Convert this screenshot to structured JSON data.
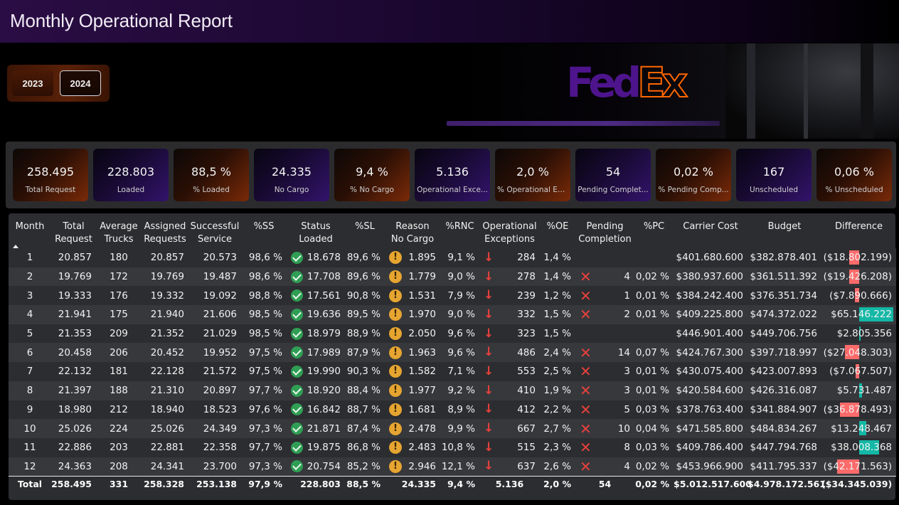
{
  "title": "Monthly Operational Report",
  "years": [
    "2023",
    "2024"
  ],
  "selected_year": "2024",
  "logo": {
    "part1": "Fed",
    "part2": "Ex"
  },
  "kpis": [
    {
      "value": "258.495",
      "label": "Total Request",
      "theme": "orange"
    },
    {
      "value": "228.803",
      "label": "Loaded",
      "theme": "purple"
    },
    {
      "value": "88,5 %",
      "label": "% Loaded",
      "theme": "orange"
    },
    {
      "value": "24.335",
      "label": "No Cargo",
      "theme": "purple"
    },
    {
      "value": "9,4 %",
      "label": "% No Cargo",
      "theme": "orange"
    },
    {
      "value": "5.136",
      "label": "Operational Exce...",
      "theme": "purple"
    },
    {
      "value": "2,0 %",
      "label": "% Operational Exce...",
      "theme": "orange"
    },
    {
      "value": "54",
      "label": "Pending Complet...",
      "theme": "purple"
    },
    {
      "value": "0,02 %",
      "label": "% Pending Comp...",
      "theme": "orange"
    },
    {
      "value": "167",
      "label": "Unscheduled",
      "theme": "purple"
    },
    {
      "value": "0,06 %",
      "label": "% Unscheduled",
      "theme": "orange"
    }
  ],
  "table": {
    "headers": [
      [
        "Month"
      ],
      [
        "Total",
        "Request"
      ],
      [
        "Average",
        "Trucks"
      ],
      [
        "Assigned",
        "Requests"
      ],
      [
        "Successful",
        "Service"
      ],
      [
        "%SS"
      ],
      [
        "Status",
        "Loaded"
      ],
      [
        "%SL"
      ],
      [
        "Reason",
        "No Cargo"
      ],
      [
        "%RNC"
      ],
      [
        "Operational",
        "Exceptions"
      ],
      [
        "%OE"
      ],
      [
        "Pending",
        "Completion"
      ],
      [
        "%PC"
      ],
      [
        "Carrier Cost"
      ],
      [
        "Budget"
      ],
      [
        "Difference"
      ]
    ],
    "rows": [
      {
        "month": "1",
        "total_request": "20.857",
        "avg_trucks": "180",
        "assigned": "20.857",
        "successful": "20.573",
        "pct_ss": "98,6 %",
        "status_loaded": "18.678",
        "pct_sl": "89,6 %",
        "no_cargo": "1.895",
        "pct_rnc": "9,1 %",
        "op_exceptions": "284",
        "pct_oe": "1,4 %",
        "pending": "",
        "pct_pc": "",
        "carrier_cost": "$401.680.600",
        "budget": "$382.878.401",
        "difference": "($18.802.199)",
        "diff_value": -18802199
      },
      {
        "month": "2",
        "total_request": "19.769",
        "avg_trucks": "172",
        "assigned": "19.769",
        "successful": "19.487",
        "pct_ss": "98,6 %",
        "status_loaded": "17.708",
        "pct_sl": "89,6 %",
        "no_cargo": "1.779",
        "pct_rnc": "9,0 %",
        "op_exceptions": "278",
        "pct_oe": "1,4 %",
        "pending": "4",
        "pct_pc": "0,02 %",
        "carrier_cost": "$380.937.600",
        "budget": "$361.511.392",
        "difference": "($19.426.208)",
        "diff_value": -19426208
      },
      {
        "month": "3",
        "total_request": "19.333",
        "avg_trucks": "176",
        "assigned": "19.332",
        "successful": "19.092",
        "pct_ss": "98,8 %",
        "status_loaded": "17.561",
        "pct_sl": "90,8 %",
        "no_cargo": "1.531",
        "pct_rnc": "7,9 %",
        "op_exceptions": "239",
        "pct_oe": "1,2 %",
        "pending": "1",
        "pct_pc": "0,01 %",
        "carrier_cost": "$384.242.400",
        "budget": "$376.351.734",
        "difference": "($7.890.666)",
        "diff_value": -7890666
      },
      {
        "month": "4",
        "total_request": "21.941",
        "avg_trucks": "175",
        "assigned": "21.940",
        "successful": "21.606",
        "pct_ss": "98,5 %",
        "status_loaded": "19.636",
        "pct_sl": "89,5 %",
        "no_cargo": "1.970",
        "pct_rnc": "9,0 %",
        "op_exceptions": "332",
        "pct_oe": "1,5 %",
        "pending": "2",
        "pct_pc": "0,01 %",
        "carrier_cost": "$409.225.800",
        "budget": "$474.372.022",
        "difference": "$65.146.222",
        "diff_value": 65146222
      },
      {
        "month": "5",
        "total_request": "21.353",
        "avg_trucks": "209",
        "assigned": "21.352",
        "successful": "21.029",
        "pct_ss": "98,5 %",
        "status_loaded": "18.979",
        "pct_sl": "88,9 %",
        "no_cargo": "2.050",
        "pct_rnc": "9,6 %",
        "op_exceptions": "323",
        "pct_oe": "1,5 %",
        "pending": "",
        "pct_pc": "",
        "carrier_cost": "$446.901.400",
        "budget": "$449.706.756",
        "difference": "$2.805.356",
        "diff_value": 2805356
      },
      {
        "month": "6",
        "total_request": "20.458",
        "avg_trucks": "206",
        "assigned": "20.452",
        "successful": "19.952",
        "pct_ss": "97,5 %",
        "status_loaded": "17.989",
        "pct_sl": "87,9 %",
        "no_cargo": "1.963",
        "pct_rnc": "9,6 %",
        "op_exceptions": "486",
        "pct_oe": "2,4 %",
        "pending": "14",
        "pct_pc": "0,07 %",
        "carrier_cost": "$424.767.300",
        "budget": "$397.718.997",
        "difference": "($27.048.303)",
        "diff_value": -27048303
      },
      {
        "month": "7",
        "total_request": "22.132",
        "avg_trucks": "181",
        "assigned": "22.128",
        "successful": "21.572",
        "pct_ss": "97,5 %",
        "status_loaded": "19.990",
        "pct_sl": "90,3 %",
        "no_cargo": "1.582",
        "pct_rnc": "7,1 %",
        "op_exceptions": "553",
        "pct_oe": "2,5 %",
        "pending": "3",
        "pct_pc": "0,01 %",
        "carrier_cost": "$430.075.400",
        "budget": "$423.007.893",
        "difference": "($7.067.507)",
        "diff_value": -7067507
      },
      {
        "month": "8",
        "total_request": "21.397",
        "avg_trucks": "188",
        "assigned": "21.310",
        "successful": "20.897",
        "pct_ss": "97,7 %",
        "status_loaded": "18.920",
        "pct_sl": "88,4 %",
        "no_cargo": "1.977",
        "pct_rnc": "9,2 %",
        "op_exceptions": "410",
        "pct_oe": "1,9 %",
        "pending": "3",
        "pct_pc": "0,01 %",
        "carrier_cost": "$420.584.600",
        "budget": "$426.316.087",
        "difference": "$5.731.487",
        "diff_value": 5731487
      },
      {
        "month": "9",
        "total_request": "18.980",
        "avg_trucks": "212",
        "assigned": "18.940",
        "successful": "18.523",
        "pct_ss": "97,6 %",
        "status_loaded": "16.842",
        "pct_sl": "88,7 %",
        "no_cargo": "1.681",
        "pct_rnc": "8,9 %",
        "op_exceptions": "412",
        "pct_oe": "2,2 %",
        "pending": "5",
        "pct_pc": "0,03 %",
        "carrier_cost": "$378.763.400",
        "budget": "$341.884.907",
        "difference": "($36.878.493)",
        "diff_value": -36878493
      },
      {
        "month": "10",
        "total_request": "25.026",
        "avg_trucks": "224",
        "assigned": "25.026",
        "successful": "24.349",
        "pct_ss": "97,3 %",
        "status_loaded": "21.871",
        "pct_sl": "87,4 %",
        "no_cargo": "2.478",
        "pct_rnc": "9,9 %",
        "op_exceptions": "667",
        "pct_oe": "2,7 %",
        "pending": "10",
        "pct_pc": "0,04 %",
        "carrier_cost": "$471.585.800",
        "budget": "$484.834.267",
        "difference": "$13.248.467",
        "diff_value": 13248467
      },
      {
        "month": "11",
        "total_request": "22.886",
        "avg_trucks": "203",
        "assigned": "22.881",
        "successful": "22.358",
        "pct_ss": "97,7 %",
        "status_loaded": "19.875",
        "pct_sl": "86,8 %",
        "no_cargo": "2.483",
        "pct_rnc": "10,8 %",
        "op_exceptions": "515",
        "pct_oe": "2,3 %",
        "pending": "8",
        "pct_pc": "0,03 %",
        "carrier_cost": "$409.786.400",
        "budget": "$447.794.768",
        "difference": "$38.008.368",
        "diff_value": 38008368
      },
      {
        "month": "12",
        "total_request": "24.363",
        "avg_trucks": "208",
        "assigned": "24.341",
        "successful": "23.700",
        "pct_ss": "97,3 %",
        "status_loaded": "20.754",
        "pct_sl": "85,2 %",
        "no_cargo": "2.946",
        "pct_rnc": "12,1 %",
        "op_exceptions": "637",
        "pct_oe": "2,6 %",
        "pending": "4",
        "pct_pc": "0,02 %",
        "carrier_cost": "$453.966.900",
        "budget": "$411.795.337",
        "difference": "($42.171.563)",
        "diff_value": -42171563
      }
    ],
    "totals": {
      "month": "Total",
      "total_request": "258.495",
      "avg_trucks": "331",
      "assigned": "258.328",
      "successful": "253.138",
      "pct_ss": "97,9 %",
      "status_loaded": "228.803",
      "pct_sl": "88,5 %",
      "no_cargo": "24.335",
      "pct_rnc": "9,4 %",
      "op_exceptions": "5.136",
      "pct_oe": "2,0 %",
      "pending": "54",
      "pct_pc": "0,02 %",
      "carrier_cost": "$5.012.517.600",
      "budget": "$4.978.172.561",
      "difference": "($34.345.039)"
    },
    "diff_colors": {
      "negative": "#fd6b6b",
      "positive": "#14b8a6"
    },
    "icons": {
      "status_loaded": "check-circle-icon",
      "no_cargo": "warning-circle-icon",
      "op_exceptions": "arrow-down-icon",
      "pending": "cross-icon"
    }
  }
}
